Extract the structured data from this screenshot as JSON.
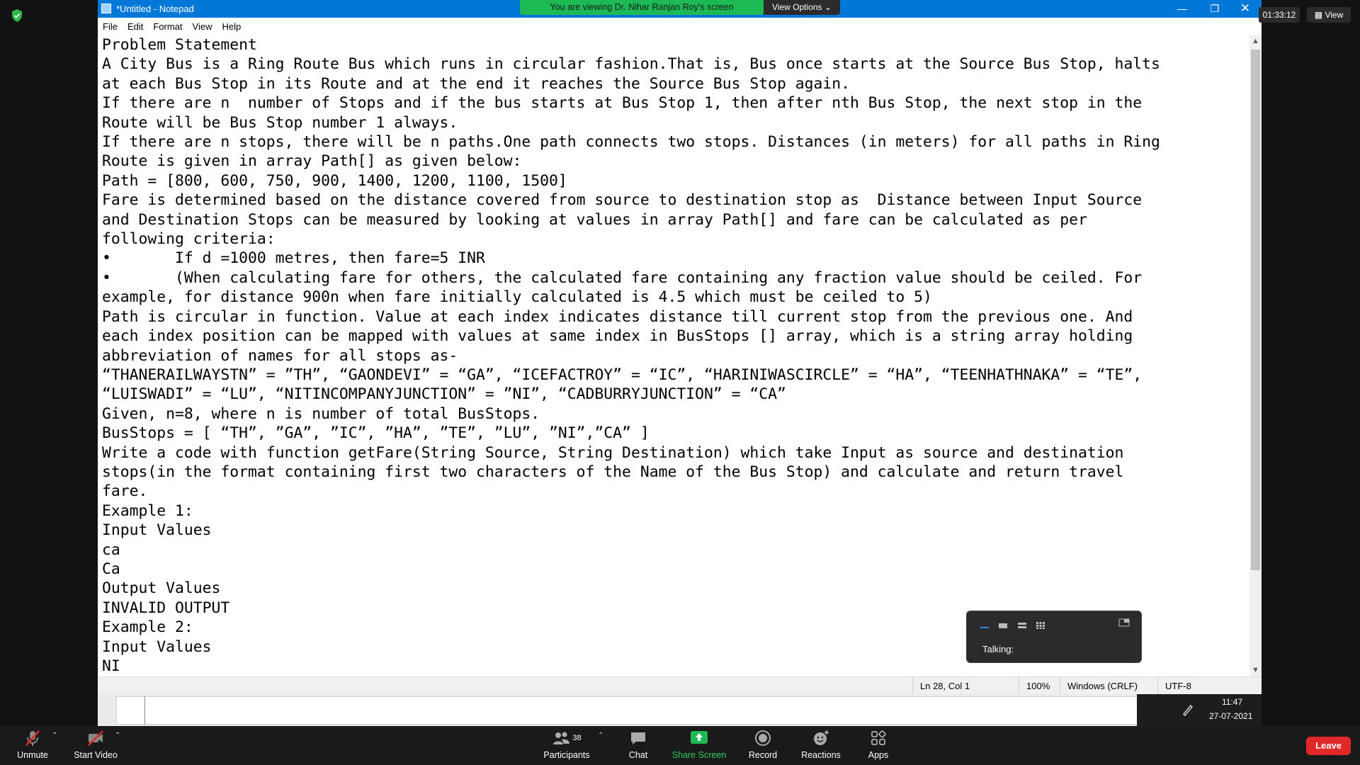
{
  "notepad": {
    "title": "*Untitled - Notepad",
    "menu": [
      "File",
      "Edit",
      "Format",
      "View",
      "Help"
    ],
    "lines": [
      "Problem Statement",
      "A City Bus is a Ring Route Bus which runs in circular fashion.That is, Bus once starts at the Source Bus Stop, halts",
      "at each Bus Stop in its Route and at the end it reaches the Source Bus Stop again.",
      "If there are n  number of Stops and if the bus starts at Bus Stop 1, then after nth Bus Stop, the next stop in the",
      "Route will be Bus Stop number 1 always.",
      "If there are n stops, there will be n paths.One path connects two stops. Distances (in meters) for all paths in Ring",
      "Route is given in array Path[] as given below:",
      "Path = [800, 600, 750, 900, 1400, 1200, 1100, 1500]",
      "Fare is determined based on the distance covered from source to destination stop as  Distance between Input Source",
      "and Destination Stops can be measured by looking at values in array Path[] and fare can be calculated as per",
      "following criteria:",
      "•       If d =1000 metres, then fare=5 INR",
      "•       (When calculating fare for others, the calculated fare containing any fraction value should be ceiled. For",
      "example, for distance 900n when fare initially calculated is 4.5 which must be ceiled to 5)",
      "Path is circular in function. Value at each index indicates distance till current stop from the previous one. And",
      "each index position can be mapped with values at same index in BusStops [] array, which is a string array holding",
      "abbreviation of names for all stops as-",
      "“THANERAILWAYSTN” = ”TH”, “GAONDEVI” = “GA”, “ICEFACTROY” = “IC”, “HARINIWASCIRCLE” = “HA”, “TEENHATHNAKA” = “TE”,",
      "“LUISWADI” = “LU”, “NITINCOMPANYJUNCTION” = ”NI”, “CADBURRYJUNCTION” = “CA”",
      "Given, n=8, where n is number of total BusStops.",
      "BusStops = [ “TH”, ”GA”, ”IC”, ”HA”, ”TE”, ”LU”, ”NI”,”CA” ]",
      "Write a code with function getFare(String Source, String Destination) which take Input as source and destination",
      "stops(in the format containing first two characters of the Name of the Bus Stop) and calculate and return travel",
      "fare.",
      "Example 1:",
      "Input Values",
      "ca",
      "Ca",
      "Output Values",
      "INVALID OUTPUT",
      "Example 2:",
      "Input Values",
      "NI"
    ],
    "status": {
      "position": "Ln 28, Col 1",
      "zoom": "100%",
      "line_ending": "Windows (CRLF)",
      "encoding": "UTF-8"
    }
  },
  "zoom": {
    "share_banner": "You are viewing Dr. Nihar Ranjan Roy's screen",
    "view_options": "View Options",
    "recording_time": "01:33:12",
    "view_label": "View",
    "talking_label": "Talking:",
    "participants_count": "38",
    "toolbar": {
      "unmute": "Unmute",
      "start_video": "Start Video",
      "participants": "Participants",
      "chat": "Chat",
      "share_screen": "Share Screen",
      "record": "Record",
      "reactions": "Reactions",
      "apps": "Apps",
      "leave": "Leave"
    },
    "colors": {
      "share_green": "#1db954",
      "leave_red": "#e02828",
      "titlebar_blue": "#0078d7"
    }
  },
  "system_tray": {
    "time": "11:47",
    "date": "27-07-2021"
  }
}
